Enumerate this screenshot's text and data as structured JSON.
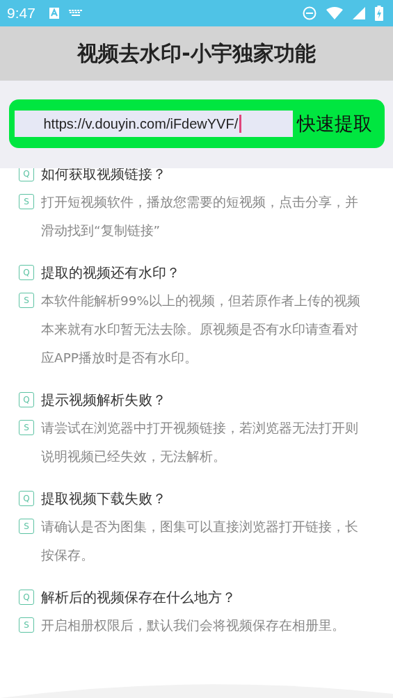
{
  "status_bar": {
    "time": "9:47"
  },
  "title": "视频去水印-小宇独家功能",
  "url_field": {
    "value": "https://v.douyin.com/iFdewYVF/",
    "focused": true
  },
  "extract_button": "快速提取",
  "faq": [
    {
      "q_badge": "Q",
      "question": "如何获取视频链接？",
      "a_badge": "S",
      "answer": "打开短视频软件，播放您需要的短视频，点击分享，并滑动找到“复制链接”"
    },
    {
      "q_badge": "Q",
      "question": "提取的视频还有水印？",
      "a_badge": "S",
      "answer": "本软件能解析99%以上的视频，但若原作者上传的视频本来就有水印暂无法去除。原视频是否有水印请查看对应APP播放时是否有水印。"
    },
    {
      "q_badge": "Q",
      "question": "提示视频解析失败？",
      "a_badge": "S",
      "answer": "请尝试在浏览器中打开视频链接，若浏览器无法打开则说明视频已经失效，无法解析。"
    },
    {
      "q_badge": "Q",
      "question": "提取视频下载失败？",
      "a_badge": "S",
      "answer": "请确认是否为图集，图集可以直接浏览器打开链接，长按保存。"
    },
    {
      "q_badge": "Q",
      "question": "解析后的视频保存在什么地方？",
      "a_badge": "S",
      "answer": "开启相册权限后，默认我们会将视频保存在相册里。"
    }
  ]
}
